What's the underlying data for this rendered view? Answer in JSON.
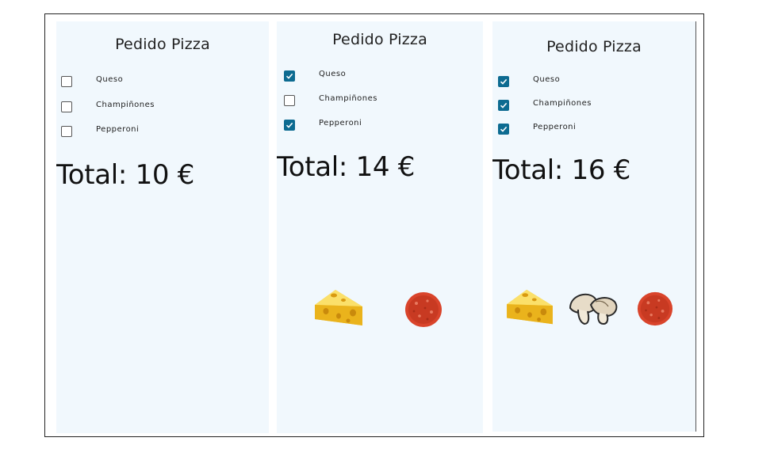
{
  "screens": [
    {
      "title": "Pedido Pizza",
      "options": [
        {
          "label": "Queso",
          "checked": false
        },
        {
          "label": "Champiñones",
          "checked": false
        },
        {
          "label": "Pepperoni",
          "checked": false
        }
      ],
      "total": "Total: 10 €",
      "ingredients_shown": []
    },
    {
      "title": "Pedido Pizza",
      "options": [
        {
          "label": "Queso",
          "checked": true
        },
        {
          "label": "Champiñones",
          "checked": false
        },
        {
          "label": "Pepperoni",
          "checked": true
        }
      ],
      "total": "Total: 14 €",
      "ingredients_shown": [
        "cheese-icon",
        "pepperoni-icon"
      ]
    },
    {
      "title": "Pedido Pizza",
      "options": [
        {
          "label": "Queso",
          "checked": true
        },
        {
          "label": "Champiñones",
          "checked": true
        },
        {
          "label": "Pepperoni",
          "checked": true
        }
      ],
      "total": "Total: 16 €",
      "ingredients_shown": [
        "cheese-icon",
        "mushroom-icon",
        "pepperoni-icon"
      ]
    }
  ],
  "colors": {
    "screen_background": "#f1f8fd",
    "checkbox_checked": "#0d6b91",
    "cheese": "#f5c52b",
    "pepperoni": "#d9442b"
  }
}
